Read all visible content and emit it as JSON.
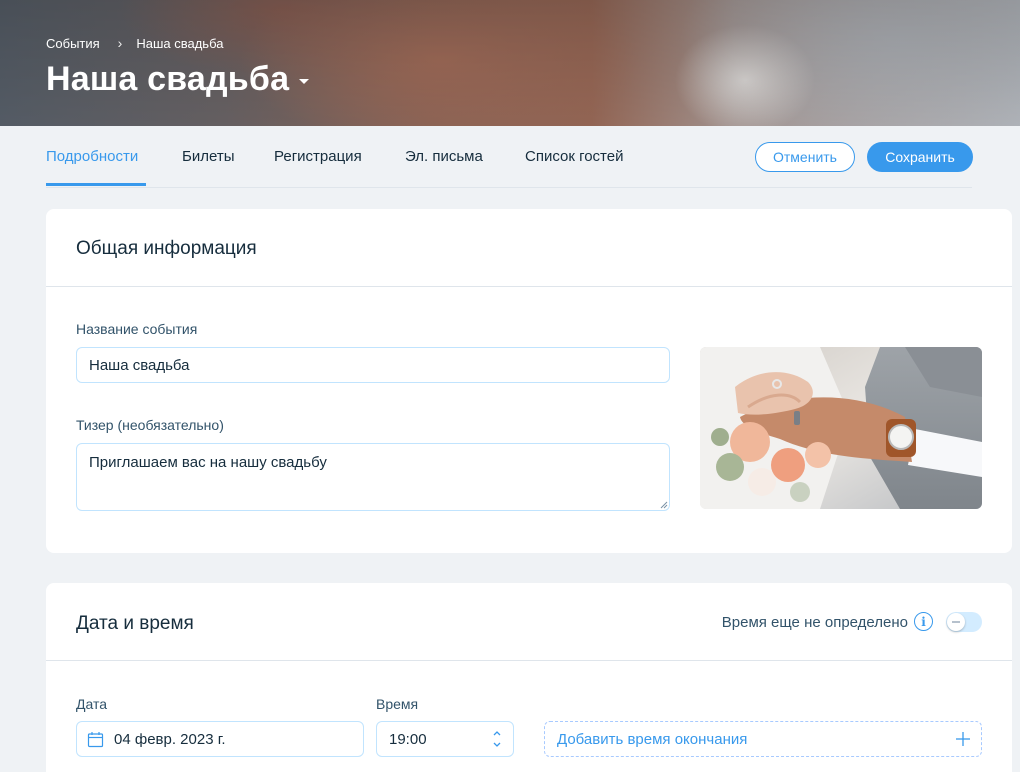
{
  "header": {
    "breadcrumb": {
      "parent": "События",
      "current": "Наша свадьба"
    },
    "title": "Наша свадьба"
  },
  "tabs": [
    {
      "label": "Подробности",
      "active": true
    },
    {
      "label": "Билеты",
      "active": false
    },
    {
      "label": "Регистрация",
      "active": false
    },
    {
      "label": "Эл. письма",
      "active": false
    },
    {
      "label": "Список гостей",
      "active": false
    }
  ],
  "actions": {
    "cancel_label": "Отменить",
    "save_label": "Сохранить"
  },
  "general": {
    "title": "Общая информация",
    "event_name_label": "Название события",
    "event_name_value": "Наша свадьба",
    "teaser_label": "Тизер (необязательно)",
    "teaser_value": "Приглашаем вас на нашу свадьбу"
  },
  "datetime": {
    "title": "Дата и время",
    "tbd_label": "Время еще не определено",
    "tbd_toggle_on": false,
    "date_label": "Дата",
    "date_value": "04 февр. 2023 г.",
    "time_label": "Время",
    "time_value": "19:00",
    "add_end_label": "Добавить время окончания"
  },
  "colors": {
    "accent": "#3899ec",
    "text": "#162d3d",
    "background": "#eff2f5"
  },
  "icons": {
    "breadcrumb_separator": "chevron-right-icon",
    "title_dropdown": "caret-down-icon",
    "info": "info-icon",
    "calendar": "calendar-icon",
    "stepper": "up-down-chevron-icon",
    "add": "plus-icon"
  }
}
